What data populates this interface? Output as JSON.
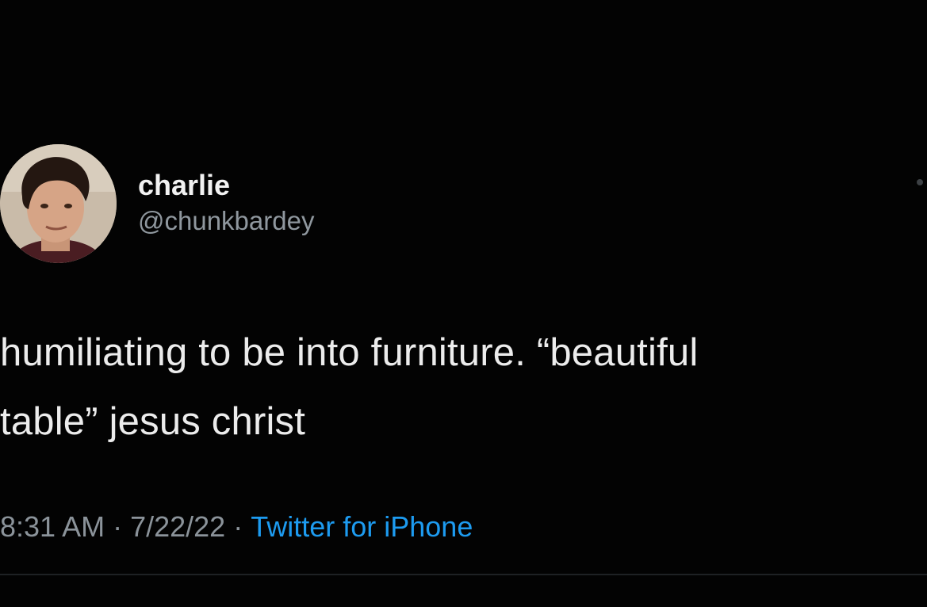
{
  "tweet": {
    "author": {
      "display_name": "charlie",
      "handle": "@chunkbardey",
      "avatar_icon": "profile-photo"
    },
    "text_lines": [
      "humiliating to be into furniture. “beautiful",
      "table” jesus christ"
    ],
    "meta": {
      "time": "8:31 AM",
      "separator": "·",
      "date": "7/22/22",
      "source": "Twitter for iPhone"
    },
    "more_icon": "more-options-icon"
  },
  "colors": {
    "background": "#030303",
    "text": "#ececec",
    "secondary": "#8b939a",
    "link": "#1d9bf0"
  }
}
